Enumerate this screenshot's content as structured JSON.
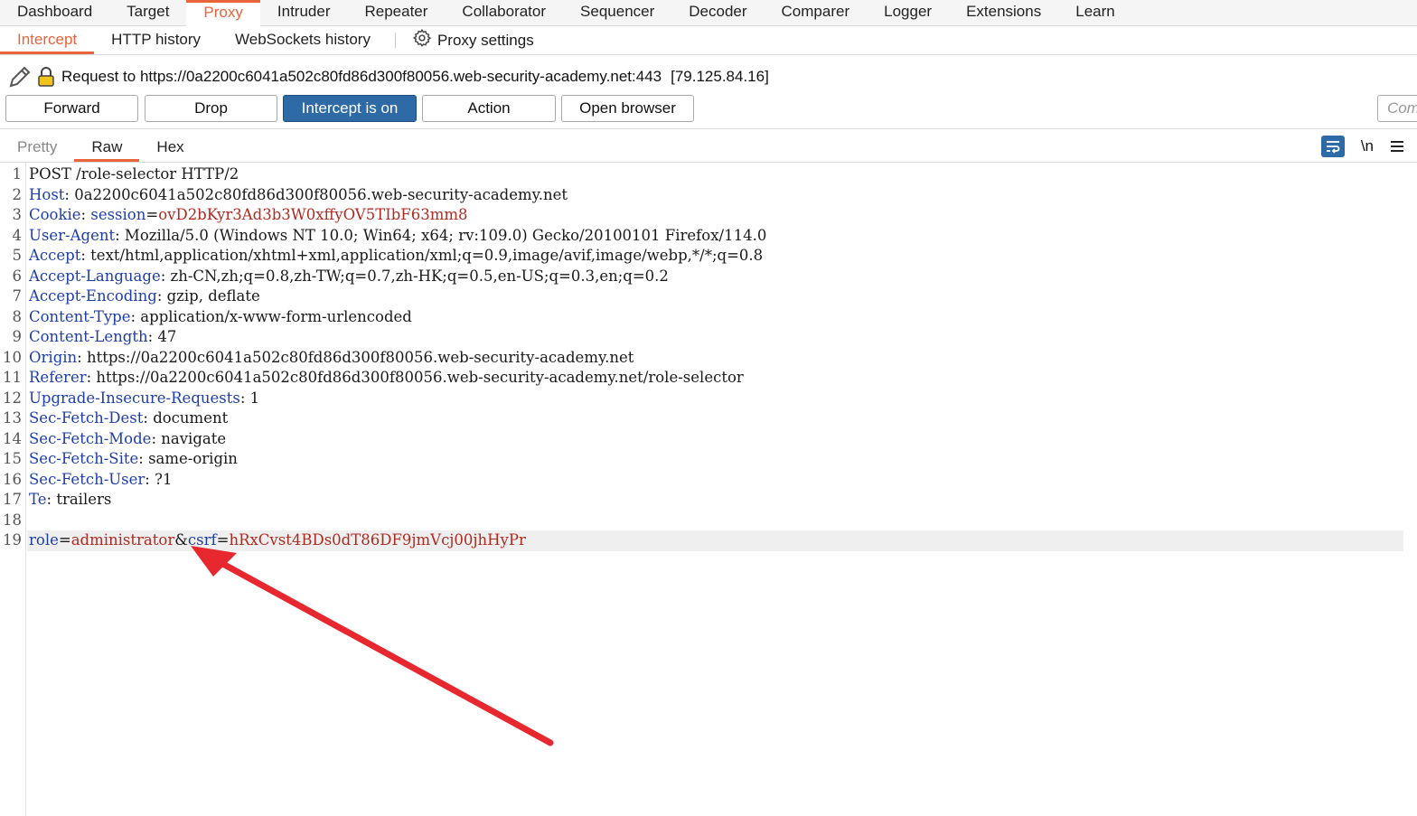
{
  "top_tabs": {
    "items": [
      {
        "label": "Dashboard"
      },
      {
        "label": "Target"
      },
      {
        "label": "Proxy"
      },
      {
        "label": "Intruder"
      },
      {
        "label": "Repeater"
      },
      {
        "label": "Collaborator"
      },
      {
        "label": "Sequencer"
      },
      {
        "label": "Decoder"
      },
      {
        "label": "Comparer"
      },
      {
        "label": "Logger"
      },
      {
        "label": "Extensions"
      },
      {
        "label": "Learn"
      }
    ],
    "active": "Proxy"
  },
  "sub_tabs": {
    "items": [
      {
        "label": "Intercept"
      },
      {
        "label": "HTTP history"
      },
      {
        "label": "WebSockets history"
      }
    ],
    "settings_label": "Proxy settings",
    "settings_icon": "gear-icon"
  },
  "request": {
    "target": "Request to https://0a2200c6041a502c80fd86d300f80056.web-security-academy.net:443",
    "ip": "[79.125.84.16]",
    "icons": [
      "pencil-icon",
      "lock-icon"
    ]
  },
  "buttons": {
    "forward": "Forward",
    "drop": "Drop",
    "intercept": "Intercept is on",
    "action": "Action",
    "open_browser": "Open browser",
    "comment_placeholder": "Com"
  },
  "editor": {
    "tabs": [
      {
        "label": "Pretty"
      },
      {
        "label": "Raw"
      },
      {
        "label": "Hex"
      }
    ],
    "active_tab": "Raw",
    "newline_label": "\\n",
    "tool_icons": [
      "wrap-icon",
      "menu-icon"
    ],
    "lines": [
      {
        "n": "1",
        "key": "",
        "sep": "",
        "val": "",
        "plain": "POST /role-selector HTTP/2"
      },
      {
        "n": "2",
        "key": "Host",
        "sep": ": ",
        "val": "",
        "plain": "0a2200c6041a502c80fd86d300f80056.web-security-academy.net"
      },
      {
        "n": "3",
        "key": "Cookie",
        "sep": ": ",
        "subkey": "session",
        "val": "ovD2bKyr3Ad3b3W0xffyOV5TIbF63mm8",
        "plain": ""
      },
      {
        "n": "4",
        "key": "User-Agent",
        "sep": ": ",
        "val": "",
        "plain": "Mozilla/5.0 (Windows NT 10.0; Win64; x64; rv:109.0) Gecko/20100101 Firefox/114.0"
      },
      {
        "n": "5",
        "key": "Accept",
        "sep": ": ",
        "val": "",
        "plain": "text/html,application/xhtml+xml,application/xml;q=0.9,image/avif,image/webp,*/*;q=0.8"
      },
      {
        "n": "6",
        "key": "Accept-Language",
        "sep": ": ",
        "val": "",
        "plain": "zh-CN,zh;q=0.8,zh-TW;q=0.7,zh-HK;q=0.5,en-US;q=0.3,en;q=0.2"
      },
      {
        "n": "7",
        "key": "Accept-Encoding",
        "sep": ": ",
        "val": "",
        "plain": "gzip, deflate"
      },
      {
        "n": "8",
        "key": "Content-Type",
        "sep": ": ",
        "val": "",
        "plain": "application/x-www-form-urlencoded"
      },
      {
        "n": "9",
        "key": "Content-Length",
        "sep": ": ",
        "val": "",
        "plain": "47"
      },
      {
        "n": "10",
        "key": "Origin",
        "sep": ": ",
        "val": "",
        "plain": "https://0a2200c6041a502c80fd86d300f80056.web-security-academy.net"
      },
      {
        "n": "11",
        "key": "Referer",
        "sep": ": ",
        "val": "",
        "plain": "https://0a2200c6041a502c80fd86d300f80056.web-security-academy.net/role-selector"
      },
      {
        "n": "12",
        "key": "Upgrade-Insecure-Requests",
        "sep": ": ",
        "val": "",
        "plain": "1"
      },
      {
        "n": "13",
        "key": "Sec-Fetch-Dest",
        "sep": ": ",
        "val": "",
        "plain": "document"
      },
      {
        "n": "14",
        "key": "Sec-Fetch-Mode",
        "sep": ": ",
        "val": "",
        "plain": "navigate"
      },
      {
        "n": "15",
        "key": "Sec-Fetch-Site",
        "sep": ": ",
        "val": "",
        "plain": "same-origin"
      },
      {
        "n": "16",
        "key": "Sec-Fetch-User",
        "sep": ": ",
        "val": "",
        "plain": "?1"
      },
      {
        "n": "17",
        "key": "Te",
        "sep": ": ",
        "val": "",
        "plain": "trailers"
      },
      {
        "n": "18",
        "key": "",
        "sep": "",
        "val": "",
        "plain": ""
      }
    ],
    "body_line": {
      "n": "19",
      "p1_key": "role",
      "p1_val": "administrator",
      "p2_key": "csrf",
      "p2_val": "hRxCvst4BDs0dT86DF9jmVcj00jhHyPr"
    }
  },
  "annotation": {
    "icon": "red-arrow-icon",
    "color": "#e8282f"
  }
}
